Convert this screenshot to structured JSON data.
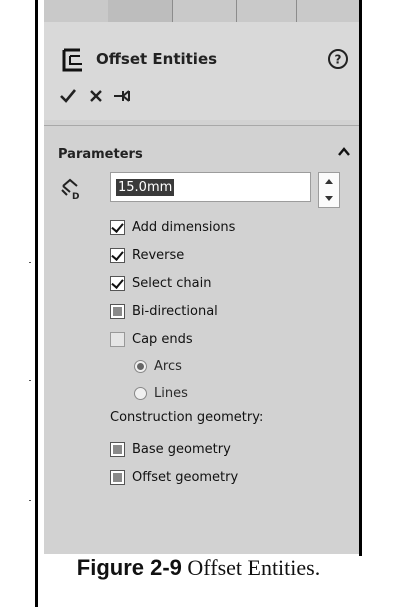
{
  "panel": {
    "title": "Offset Entities",
    "help_icon": "help-icon",
    "actions": [
      {
        "name": "ok-icon",
        "glyph": "✔"
      },
      {
        "name": "cancel-icon",
        "glyph": "✕"
      },
      {
        "name": "pushpin-icon",
        "glyph": "pin"
      }
    ]
  },
  "parameters": {
    "title": "Parameters",
    "distance_value": "15.0mm",
    "options": [
      {
        "label": "Add dimensions",
        "checked": true
      },
      {
        "label": "Reverse",
        "checked": true
      },
      {
        "label": "Select chain",
        "checked": true
      },
      {
        "label": "Bi-directional",
        "checked": false,
        "indeterminate": true
      },
      {
        "label": "Cap ends",
        "checked": false,
        "disabled": true
      }
    ],
    "cap_types": [
      {
        "label": "Arcs",
        "selected": true
      },
      {
        "label": "Lines",
        "selected": false
      }
    ],
    "construction_label": "Construction geometry:",
    "construction_options": [
      {
        "label": "Base geometry",
        "checked": false
      },
      {
        "label": "Offset geometry",
        "checked": false
      }
    ]
  },
  "caption": {
    "figure": "Figure 2-9",
    "text": " Offset Entities."
  },
  "colors": {
    "panel_bg": "#d2d2d2",
    "selection": "#3a3a3a"
  }
}
